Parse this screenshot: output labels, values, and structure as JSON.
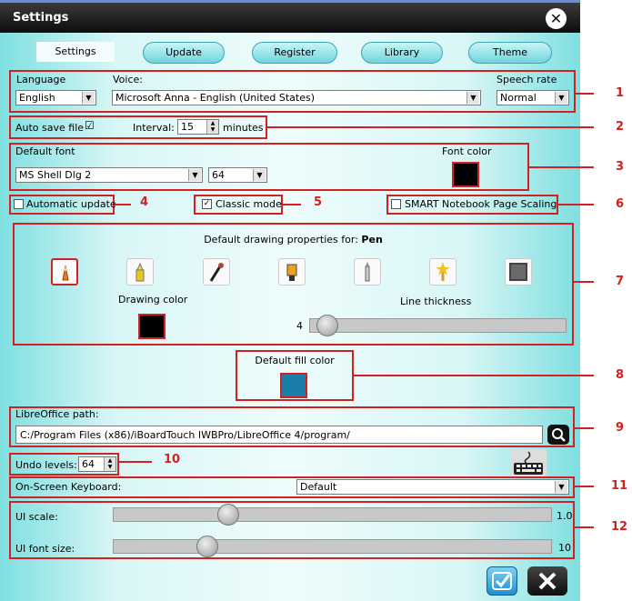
{
  "window": {
    "title": "Settings"
  },
  "tabs": [
    {
      "label": "Settings"
    },
    {
      "label": "Update"
    },
    {
      "label": "Register"
    },
    {
      "label": "Library"
    },
    {
      "label": "Theme"
    }
  ],
  "language": {
    "label": "Language",
    "value": "English"
  },
  "voice": {
    "label": "Voice:",
    "value": "Microsoft Anna - English (United States)"
  },
  "speech_rate": {
    "label": "Speech rate",
    "value": "Normal"
  },
  "autosave": {
    "label": "Auto save file",
    "checked_glyph": "☑",
    "interval_label": "Interval:",
    "interval_value": "15",
    "interval_unit": "minutes"
  },
  "default_font": {
    "label": "Default font",
    "value": "MS Shell Dlg 2",
    "size": "64"
  },
  "font_color": {
    "label": "Font color",
    "color": "#000000"
  },
  "automatic_update": {
    "label": "Automatic update",
    "checked": false
  },
  "classic_mode": {
    "label": "Classic mode",
    "checked": true,
    "checked_glyph": "✓"
  },
  "smart_scaling": {
    "label": "SMART Notebook Page Scaling",
    "checked": false
  },
  "drawing": {
    "heading_prefix": "Default drawing properties for:",
    "heading_tool": "Pen",
    "tools": [
      "pen-icon",
      "highlighter-icon",
      "brush-icon",
      "marker-icon",
      "pencil-icon",
      "magic-pen-icon",
      "eraser-icon"
    ],
    "drawing_color_label": "Drawing color",
    "drawing_color": "#000000",
    "line_thickness_label": "Line thickness",
    "line_thickness_value": "4",
    "line_thickness_fraction": 0.03
  },
  "fill": {
    "label": "Default fill color",
    "color": "#1a7fa8"
  },
  "libreoffice": {
    "label": "LibreOffice path:",
    "value": "C:/Program Files (x86)/iBoardTouch IWBPro/LibreOffice 4/program/"
  },
  "undo": {
    "label": "Undo levels:",
    "value": "64"
  },
  "keyboard": {
    "label": "On-Screen Keyboard:",
    "value": "Default"
  },
  "ui_scale": {
    "label": "UI scale:",
    "value": "1.0",
    "fraction": 0.25
  },
  "ui_font_size": {
    "label": "UI font size:",
    "value": "10",
    "fraction": 0.2
  },
  "callouts": [
    "1",
    "2",
    "3",
    "4",
    "5",
    "6",
    "7",
    "8",
    "9",
    "10",
    "11",
    "12"
  ],
  "accent_colors": {
    "callout": "#d32020",
    "ok": "#2a9fd8"
  }
}
